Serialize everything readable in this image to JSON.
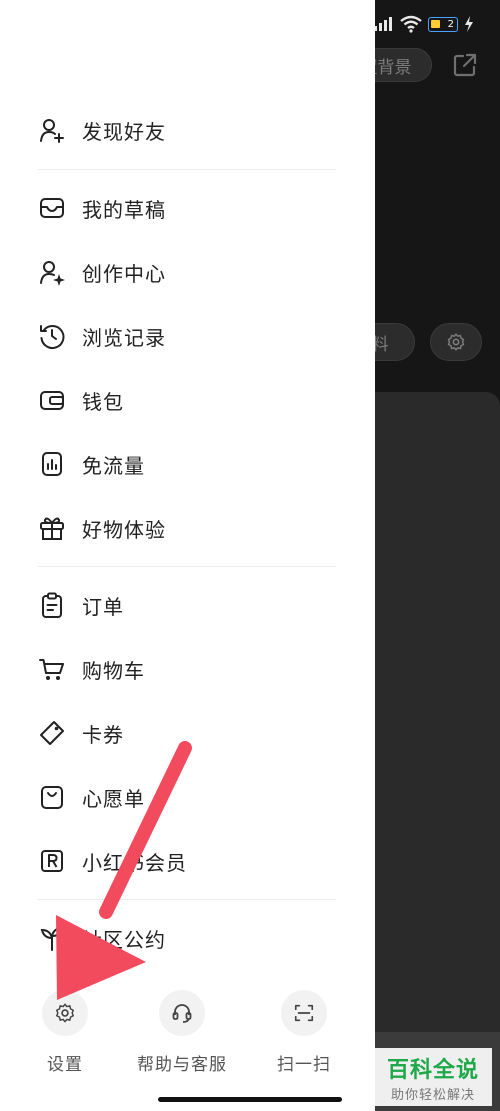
{
  "status_bar": {
    "battery_level": "2"
  },
  "background": {
    "set_background_button": "置背景",
    "profile_button": "料"
  },
  "drawer": {
    "items": [
      {
        "label": "发现好友",
        "icon": "add-friend-icon"
      },
      {
        "label": "我的草稿",
        "icon": "drafts-inbox-icon"
      },
      {
        "label": "创作中心",
        "icon": "creator-center-icon"
      },
      {
        "label": "浏览记录",
        "icon": "history-clock-icon"
      },
      {
        "label": "钱包",
        "icon": "wallet-icon"
      },
      {
        "label": "免流量",
        "icon": "free-data-icon"
      },
      {
        "label": "好物体验",
        "icon": "gift-icon"
      },
      {
        "label": "订单",
        "icon": "order-clipboard-icon"
      },
      {
        "label": "购物车",
        "icon": "cart-icon"
      },
      {
        "label": "卡券",
        "icon": "coupon-tag-icon"
      },
      {
        "label": "心愿单",
        "icon": "wishlist-bag-icon"
      },
      {
        "label": "小红书会员",
        "icon": "membership-r-icon"
      },
      {
        "label": "社区公约",
        "icon": "sprout-icon"
      }
    ],
    "bottom_actions": [
      {
        "label": "设置",
        "icon": "settings-gear-icon"
      },
      {
        "label": "帮助与客服",
        "icon": "headset-icon"
      },
      {
        "label": "扫一扫",
        "icon": "scan-icon"
      }
    ]
  },
  "watermark": {
    "title": "百科全说",
    "subtitle": "助你轻松解决"
  },
  "colors": {
    "arrow": "#f24b5e",
    "watermark_green": "#1fa84a",
    "drawer_bg": "#ffffff",
    "overlay_bg": "#161616"
  }
}
